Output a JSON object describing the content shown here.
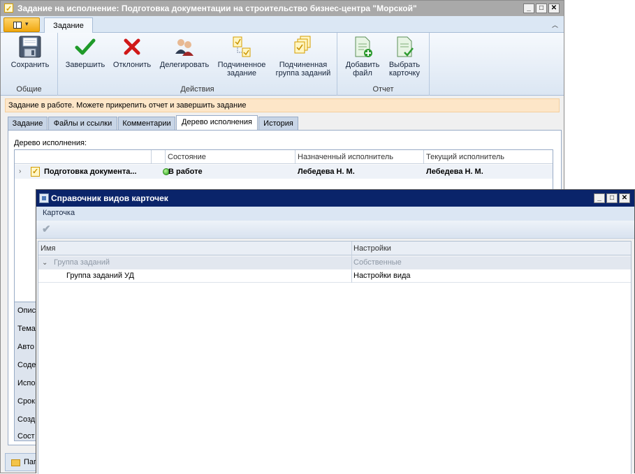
{
  "main_window": {
    "title": "Задание на исполнение: Подготовка документации на строительство бизнес-центра \"Морской\"",
    "controls": {
      "minimize": "_",
      "maximize": "□",
      "close": "✕"
    }
  },
  "ribbon": {
    "app_button_caret": "▾",
    "collapse_glyph": "︿",
    "tab_label": "Задание",
    "groups": {
      "general": {
        "label": "Общие",
        "save_label": "Сохранить"
      },
      "actions": {
        "label": "Действия",
        "complete_label": "Завершить",
        "reject_label": "Отклонить",
        "delegate_label": "Делегировать",
        "subtask_line1": "Подчиненное",
        "subtask_line2": "задание",
        "subgroup_line1": "Подчиненная",
        "subgroup_line2": "группа заданий"
      },
      "report": {
        "label": "Отчет",
        "add_file_line1": "Добавить",
        "add_file_line2": "файл",
        "select_card_line1": "Выбрать",
        "select_card_line2": "карточку"
      }
    }
  },
  "info_bar": {
    "text": "Задание в работе. Можете прикрепить отчет и завершить задание"
  },
  "content_tabs": [
    "Задание",
    "Файлы и ссылки",
    "Комментарии",
    "Дерево исполнения",
    "История"
  ],
  "execution_tree": {
    "caption": "Дерево исполнения:",
    "columns": [
      "",
      "",
      "Состояние",
      "Назначенный исполнитель",
      "Текущий исполнитель"
    ],
    "expander": "›",
    "row": {
      "name": "Подготовка документа...",
      "status": "В работе",
      "assigned": "Лебедева Н. М.",
      "current": "Лебедева Н. М."
    }
  },
  "properties": [
    "Опис",
    "Тема",
    "Авто",
    "Соде",
    "Испо",
    "Срок",
    "Созд",
    "Сост"
  ],
  "bottom_bar": {
    "label": "Пап"
  },
  "dialog": {
    "title": "Справочник видов карточек",
    "controls": {
      "minimize": "_",
      "maximize": "□",
      "close": "✕"
    },
    "menu": {
      "card": "Карточка"
    },
    "toolbar": {
      "apply_glyph": "✔"
    },
    "grid": {
      "columns": [
        "Имя",
        "Настройки"
      ],
      "group": {
        "toggle": "⌄",
        "name": "Группа заданий",
        "settings": "Собственные"
      },
      "rows": [
        {
          "name": "Группа заданий УД",
          "settings": "Настройки вида"
        }
      ]
    }
  },
  "colors": {
    "main_title_bg": "#a9a9a9",
    "dialog_title_bg": "#0a246a",
    "info_bar_bg": "#fde6c8",
    "status_green": "#27a418",
    "reject_red": "#d01818",
    "complete_green": "#1f9a2a"
  },
  "icons": {
    "save": "floppy-disk-icon",
    "complete": "checkmark-icon",
    "reject": "red-x-icon",
    "delegate": "users-icon",
    "subtask": "subtask-icon",
    "subgroup": "task-group-icon",
    "add_file": "document-add-icon",
    "select_card": "document-check-icon"
  }
}
